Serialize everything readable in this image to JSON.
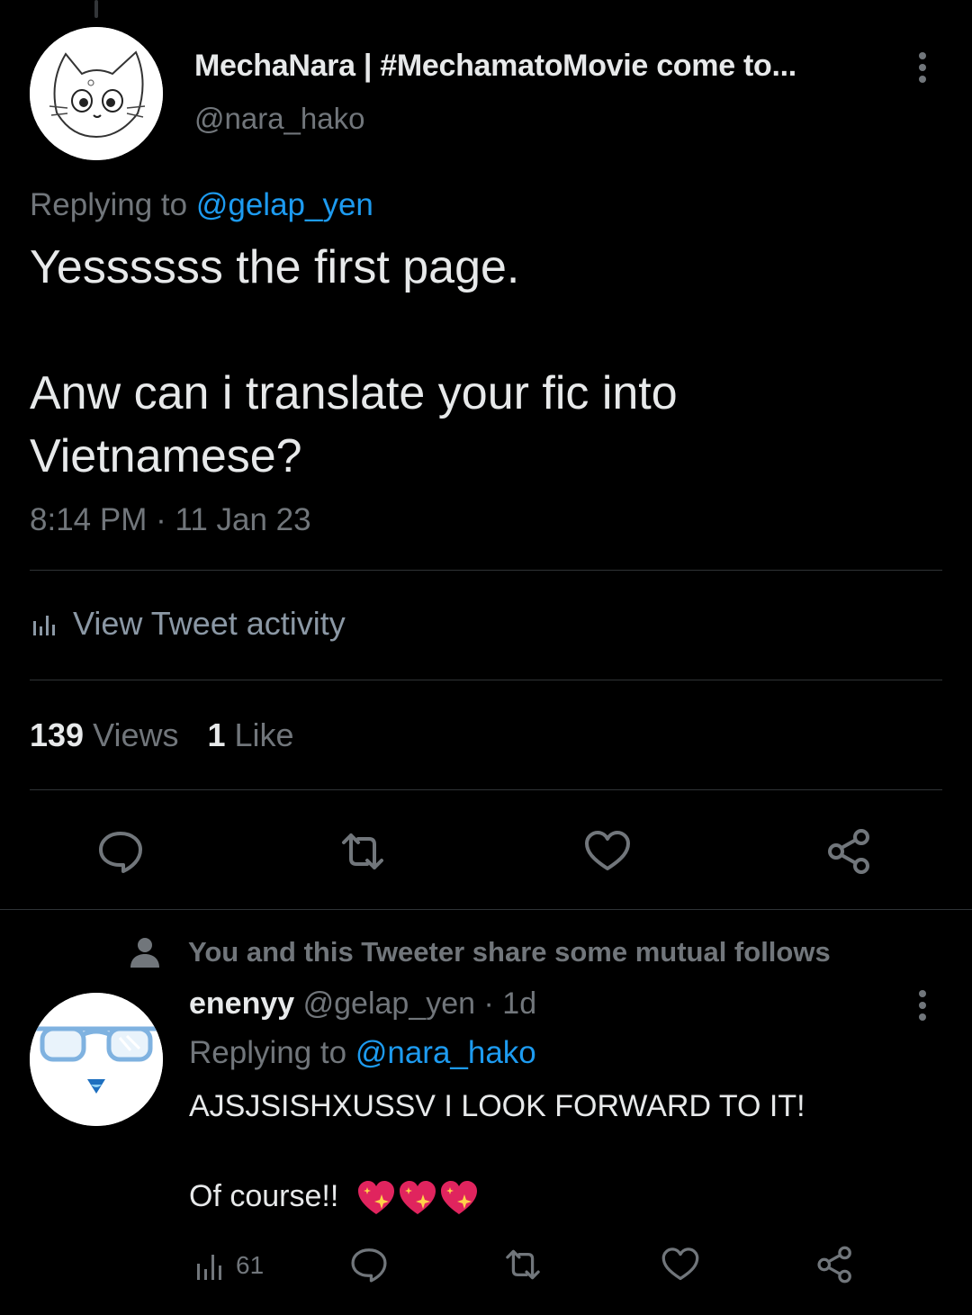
{
  "tweet": {
    "display_name": "MechaNara | #MechamatoMovie come to...",
    "handle": "@nara_hako",
    "replying_prefix": "Replying to ",
    "replying_to": "@gelap_yen",
    "body_lines": [
      "Yessssss the first page.",
      "Anw can i translate your fic into",
      "Vietnamese?"
    ],
    "timestamp": "8:14 PM · 11 Jan 23",
    "activity_label": "View Tweet activity",
    "views_count": "139",
    "views_label": " Views",
    "likes_count": "1",
    "likes_label": " Like",
    "icons": [
      "reply-icon",
      "retweet-icon",
      "like-icon",
      "share-icon"
    ]
  },
  "reply": {
    "mutual_notice": "You and this Tweeter share some mutual follows",
    "display_name": "enenyy",
    "handle_time": " @gelap_yen · 1d",
    "replying_prefix": "Replying to ",
    "replying_to": "@nara_hako",
    "body_line1": "AJSJSISHXUSSV I LOOK FORWARD TO IT!",
    "body_line2": "Of course!!",
    "emoji": [
      "sparkling-heart",
      "sparkling-heart",
      "sparkling-heart"
    ],
    "views": "61"
  },
  "colors": {
    "background": "#000000",
    "text": "#e7e9ea",
    "muted": "#71767b",
    "link": "#1d9bf0",
    "divider": "#2f3336"
  }
}
